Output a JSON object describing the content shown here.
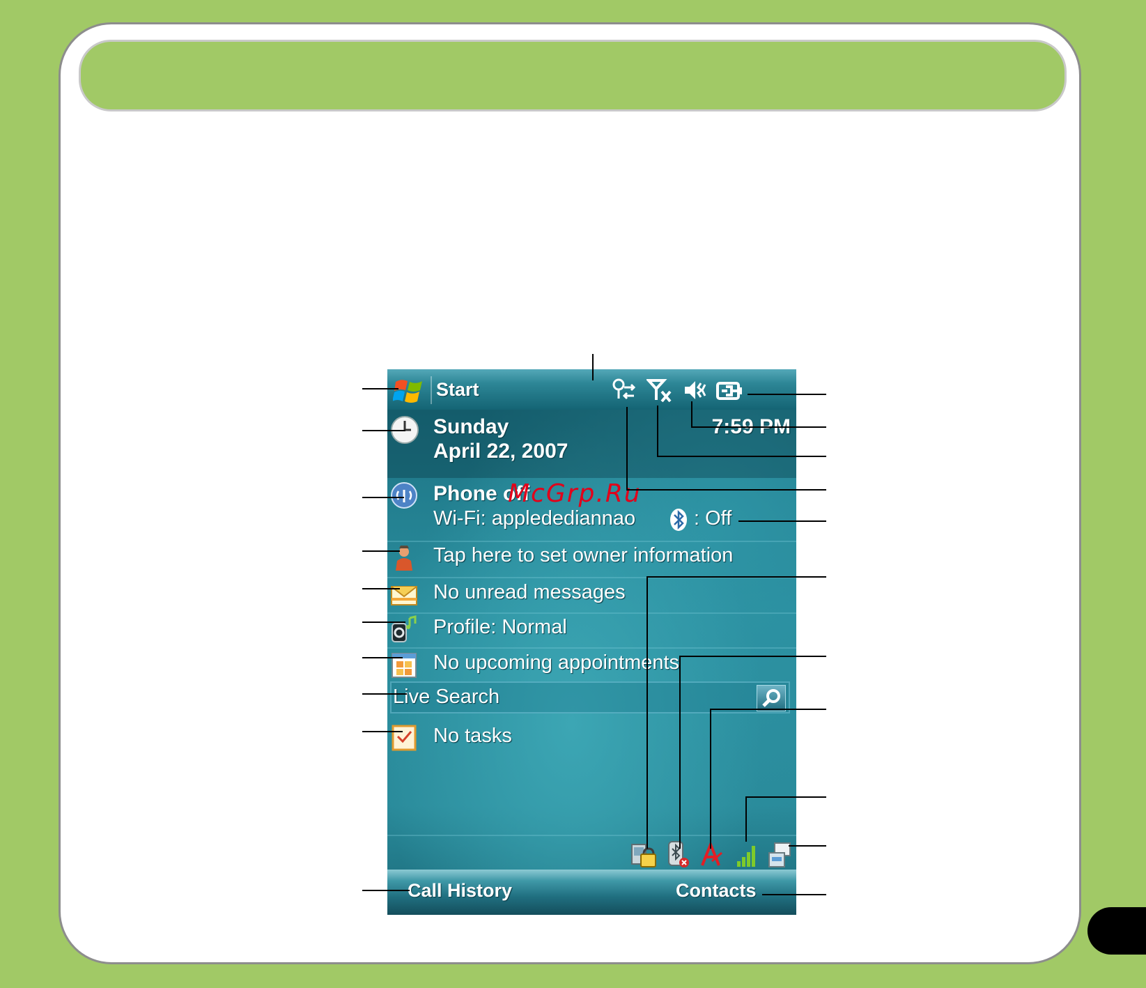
{
  "phone": {
    "start_label": "Start",
    "clock_time": "7:59 PM",
    "day": "Sunday",
    "date": "April 22, 2007",
    "phone_status": "Phone off",
    "wifi_status": "Wi-Fi: appledediannao",
    "bluetooth_status": ": Off",
    "owner_info": "Tap here to set owner information",
    "messages": "No unread messages",
    "profile": "Profile: Normal",
    "appointments": "No upcoming appointments",
    "search_placeholder": "Live Search",
    "tasks": "No tasks",
    "softkey_left": "Call History",
    "softkey_right": "Contacts"
  },
  "icons": {
    "start": "windows-flag-icon",
    "connectivity": "connectivity-icon",
    "signal_off": "no-signal-icon",
    "volume": "speaker-icon",
    "battery": "battery-plug-icon",
    "clock": "clock-icon",
    "phone": "phone-antenna-icon",
    "bluetooth": "bluetooth-icon",
    "owner": "owner-person-icon",
    "messages": "envelope-icon",
    "profile": "profile-music-icon",
    "calendar": "calendar-icon",
    "search": "magnifier-icon",
    "tasks": "task-checkbox-icon",
    "device_lock": "device-lock-icon",
    "bluetooth_off": "bluetooth-off-icon",
    "sync": "activesync-icon",
    "signal_strength": "signal-strength-icon",
    "wireless_manager": "wireless-manager-icon"
  },
  "watermark": "McGrp.Ru",
  "colors": {
    "page_green": "#a1c966",
    "frame_gray": "#8d8d8d",
    "screen_teal": "#2a8d9d",
    "watermark_red": "#e2001a"
  }
}
